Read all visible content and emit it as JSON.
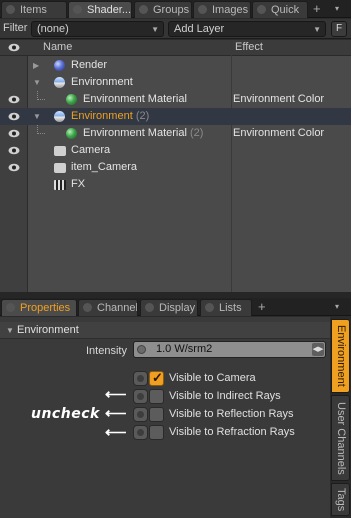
{
  "top_tabs": [
    "Items",
    "Shader...",
    "Groups",
    "Images",
    "Quick"
  ],
  "top_plus": "+",
  "filter": {
    "label": "Filter",
    "value": "(none)",
    "add_layer": "Add Layer",
    "f_button": "F"
  },
  "tree": {
    "headers": {
      "name": "Name",
      "effect": "Effect"
    },
    "rows": [
      {
        "name": "Render",
        "effect": "",
        "count": "",
        "icon": "render-sphere-icon",
        "eye": false
      },
      {
        "name": "Environment",
        "effect": "",
        "count": "",
        "icon": "environment-icon",
        "eye": false
      },
      {
        "name": "Environment Material",
        "effect": "Environment Color",
        "count": "",
        "icon": "material-sphere-icon",
        "eye": true
      },
      {
        "name": "Environment",
        "effect": "",
        "count": "(2)",
        "icon": "environment-icon",
        "eye": true,
        "selected": true
      },
      {
        "name": "Environment Material",
        "effect": "Environment Color",
        "count": "(2)",
        "icon": "material-sphere-icon",
        "eye": true
      },
      {
        "name": "Camera",
        "effect": "",
        "count": "",
        "icon": "camera-icon",
        "eye": true
      },
      {
        "name": "item_Camera",
        "effect": "",
        "count": "",
        "icon": "camera-icon",
        "eye": true
      },
      {
        "name": "FX",
        "effect": "",
        "count": "",
        "icon": "clapper-icon",
        "eye": false
      }
    ]
  },
  "bottom_tabs": [
    "Properties",
    "Channels",
    "Display",
    "Lists"
  ],
  "bottom_plus": "+",
  "properties": {
    "section": "Environment",
    "intensity_label": "Intensity",
    "intensity_value": "1.0 W/srm2",
    "checks": [
      {
        "label": "Visible to Camera",
        "checked": true
      },
      {
        "label": "Visible to Indirect Rays",
        "checked": false
      },
      {
        "label": "Visible to Reflection Rays",
        "checked": false
      },
      {
        "label": "Visible to Refraction Rays",
        "checked": false
      }
    ]
  },
  "annotation": "uncheck",
  "side_tabs": [
    "Environment",
    "User Channels",
    "Tags"
  ],
  "colors": {
    "accent": "#f0a020",
    "selected_row": "#313843",
    "panel": "#4a4a4a"
  }
}
